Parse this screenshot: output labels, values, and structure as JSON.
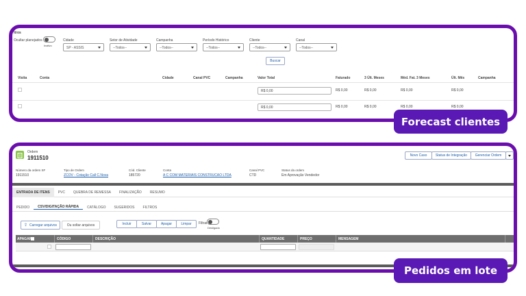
{
  "forecast": {
    "filters_title": "ltros",
    "ocultar_label": "Ocultar planejados",
    "ocultar_sub": "Inativo",
    "filters": [
      {
        "label": "Cidade",
        "value": "SP - ASSIS"
      },
      {
        "label": "Setor de Atividade",
        "value": "--Todos--"
      },
      {
        "label": "Campanha",
        "value": "--Todos--"
      },
      {
        "label": "Período Histórico",
        "value": "--Todos--"
      },
      {
        "label": "Cliente",
        "value": "--Todos--"
      },
      {
        "label": "Canal",
        "value": "--Todos--"
      }
    ],
    "search_button": "Buscar",
    "columns": [
      "Visita",
      "Conta",
      "Cidade",
      "Canal PVC",
      "Campanha",
      "Valor Total",
      "Faturado",
      "3 Últ. Meses",
      "Méd. Fat. 3 Meses",
      "Últ. Mês",
      "Campanha"
    ],
    "rows": [
      {
        "valor_total": "R$ 0,00",
        "faturado": "R$ 0,00",
        "ult3": "R$ 0,00",
        "med3": "R$ 0,00",
        "ultmes": "R$ 0,00"
      },
      {
        "valor_total": "R$ 0,00",
        "faturado": "R$ 0,00",
        "ult3": "R$ 0,00",
        "med3": "R$ 0,00",
        "ultmes": "R$ 0,00"
      }
    ],
    "badge": "Forecast clientes"
  },
  "pedidos": {
    "ordem_label": "Ordem",
    "ordem_number": "1911510",
    "actions": [
      "Novo Caso",
      "Status de Integração",
      "Gerenciar Ordem"
    ],
    "info": [
      {
        "label": "Número da ordem SF",
        "value": "1911510",
        "link": false
      },
      {
        "label": "Tipo de Ordem",
        "value": "ZCOV - Cotação Call C.Nova",
        "link": true
      },
      {
        "label": "Cód. Cliente",
        "value": "185720",
        "link": false
      },
      {
        "label": "Conta",
        "value": "A C COM MATERIAIS CONSTRUCAO LTDA",
        "link": true
      },
      {
        "label": "Canal PVC",
        "value": "CTD",
        "link": false
      },
      {
        "label": "Status da ordem",
        "value": "Em Aprovação Vendedor",
        "link": false
      }
    ],
    "main_tabs": [
      "ENTRADA DE ITENS",
      "PVC",
      "QUEBRA DE REMESSA",
      "FINALIZAÇÃO",
      "RESUMO"
    ],
    "sub_tabs": [
      "PEDIDO",
      "CSV/DIGITAÇÃO RÁPIDA",
      "CATÁLOGO",
      "SUGERIDOS",
      "FILTROS"
    ],
    "upload_button": "Carregar arquivos",
    "drop_text": "Ou soltar arquivos",
    "table_actions": [
      "Incluir",
      "Salvar",
      "Apagar",
      "Limpar"
    ],
    "filtrar_label": "Filtrar",
    "filtrar_sub": "Desligado",
    "grid_columns": [
      "APAGAR",
      "CÓDIGO",
      "DESCRIÇÃO",
      "QUANTIDADE",
      "PREÇO",
      "MENSAGEM"
    ],
    "badge": "Pedidos em lote"
  },
  "colors": {
    "frame": "#6a0dad",
    "badge": "#5a19b4",
    "link": "#1f5ea8",
    "ordem_icon": "#8bc34a"
  }
}
